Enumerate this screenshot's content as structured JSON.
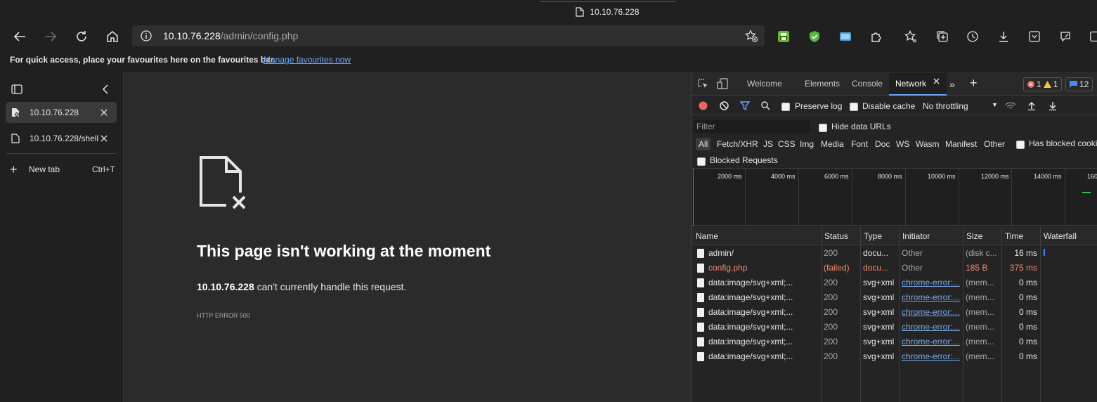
{
  "window": {
    "title": "10.10.76.228"
  },
  "nav": {
    "back_icon": "arrow-left-icon",
    "forward_icon": "arrow-right-icon",
    "refresh_icon": "refresh-icon",
    "home_icon": "home-icon"
  },
  "address": {
    "host": "10.10.76.228",
    "path": "/admin/config.php"
  },
  "favourites_bar": {
    "message": "For quick access, place your favourites here on the favourites bar.",
    "link": "Manage favourites now"
  },
  "sidebar": {
    "tabs": [
      {
        "label": "10.10.76.228",
        "active": true
      },
      {
        "label": "10.10.76.228/shell",
        "active": false
      }
    ],
    "new_tab": {
      "label": "New tab",
      "shortcut": "Ctrl+T"
    }
  },
  "page": {
    "title": "This page isn't working at the moment",
    "host": "10.10.76.228",
    "message": " can't currently handle this request.",
    "error_code": "HTTP ERROR 500"
  },
  "devtools": {
    "tabs": [
      "Welcome",
      "Elements",
      "Console",
      "Network"
    ],
    "active_tab": "Network",
    "errors": "1",
    "warnings": "1",
    "messages": "12",
    "toolbar": {
      "preserve_log": "Preserve log",
      "disable_cache": "Disable cache",
      "throttling": "No throttling"
    },
    "filter": {
      "placeholder": "Filter",
      "hide_data_urls": "Hide data URLs",
      "types": [
        "All",
        "Fetch/XHR",
        "JS",
        "CSS",
        "Img",
        "Media",
        "Font",
        "Doc",
        "WS",
        "Wasm",
        "Manifest",
        "Other"
      ],
      "has_blocked_cookies": "Has blocked cookies",
      "blocked_requests": "Blocked Requests"
    },
    "timeline_ticks": [
      "2000 ms",
      "4000 ms",
      "6000 ms",
      "8000 ms",
      "10000 ms",
      "12000 ms",
      "14000 ms",
      "160"
    ],
    "columns": [
      "Name",
      "Status",
      "Type",
      "Initiator",
      "Size",
      "Time",
      "Waterfall"
    ],
    "rows": [
      {
        "name": "admin/",
        "status": "200",
        "type": "docu...",
        "initiator": "Other",
        "size": "(disk c...",
        "time": "16 ms",
        "failed": false,
        "link": false
      },
      {
        "name": "config.php",
        "status": "(failed)",
        "type": "docu...",
        "initiator": "Other",
        "size": "185 B",
        "time": "375 ms",
        "failed": true,
        "link": false
      },
      {
        "name": "data:image/svg+xml;...",
        "status": "200",
        "type": "svg+xml",
        "initiator": "chrome-error:...",
        "size": "(mem...",
        "time": "0 ms",
        "failed": false,
        "link": true
      },
      {
        "name": "data:image/svg+xml;...",
        "status": "200",
        "type": "svg+xml",
        "initiator": "chrome-error:...",
        "size": "(mem...",
        "time": "0 ms",
        "failed": false,
        "link": true
      },
      {
        "name": "data:image/svg+xml;...",
        "status": "200",
        "type": "svg+xml",
        "initiator": "chrome-error:...",
        "size": "(mem...",
        "time": "0 ms",
        "failed": false,
        "link": true
      },
      {
        "name": "data:image/svg+xml;...",
        "status": "200",
        "type": "svg+xml",
        "initiator": "chrome-error:...",
        "size": "(mem...",
        "time": "0 ms",
        "failed": false,
        "link": true
      },
      {
        "name": "data:image/svg+xml;...",
        "status": "200",
        "type": "svg+xml",
        "initiator": "chrome-error:...",
        "size": "(mem...",
        "time": "0 ms",
        "failed": false,
        "link": true
      },
      {
        "name": "data:image/svg+xml;...",
        "status": "200",
        "type": "svg+xml",
        "initiator": "chrome-error:...",
        "size": "(mem...",
        "time": "0 ms",
        "failed": false,
        "link": true
      }
    ]
  }
}
